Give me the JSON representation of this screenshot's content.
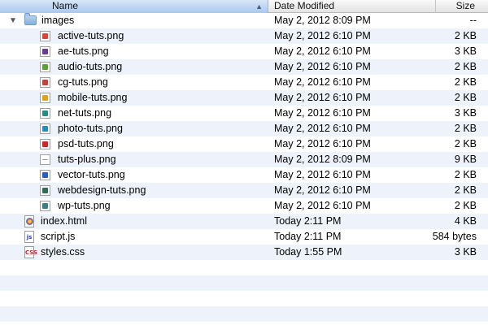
{
  "header": {
    "name": "Name",
    "date_modified": "Date Modified",
    "size": "Size"
  },
  "folder": {
    "name": "images",
    "date": "May 2, 2012 8:09 PM",
    "size": "--",
    "files": [
      {
        "name": "active-tuts.png",
        "date": "May 2, 2012 6:10 PM",
        "size": "2 KB",
        "color": "#d8453a"
      },
      {
        "name": "ae-tuts.png",
        "date": "May 2, 2012 6:10 PM",
        "size": "3 KB",
        "color": "#6a3d8f"
      },
      {
        "name": "audio-tuts.png",
        "date": "May 2, 2012 6:10 PM",
        "size": "2 KB",
        "color": "#5aa032"
      },
      {
        "name": "cg-tuts.png",
        "date": "May 2, 2012 6:10 PM",
        "size": "2 KB",
        "color": "#c2453c"
      },
      {
        "name": "mobile-tuts.png",
        "date": "May 2, 2012 6:10 PM",
        "size": "2 KB",
        "color": "#e0a020"
      },
      {
        "name": "net-tuts.png",
        "date": "May 2, 2012 6:10 PM",
        "size": "3 KB",
        "color": "#2a8a84"
      },
      {
        "name": "photo-tuts.png",
        "date": "May 2, 2012 6:10 PM",
        "size": "2 KB",
        "color": "#2a8bc0"
      },
      {
        "name": "psd-tuts.png",
        "date": "May 2, 2012 6:10 PM",
        "size": "2 KB",
        "color": "#c82a2a"
      },
      {
        "name": "tuts-plus.png",
        "date": "May 2, 2012 8:09 PM",
        "size": "9 KB",
        "color": "#999999"
      },
      {
        "name": "vector-tuts.png",
        "date": "May 2, 2012 6:10 PM",
        "size": "2 KB",
        "color": "#2a5fb8"
      },
      {
        "name": "webdesign-tuts.png",
        "date": "May 2, 2012 6:10 PM",
        "size": "2 KB",
        "color": "#2f6e5a"
      },
      {
        "name": "wp-tuts.png",
        "date": "May 2, 2012 6:10 PM",
        "size": "2 KB",
        "color": "#3a7f86"
      }
    ]
  },
  "root_files": [
    {
      "name": "index.html",
      "date": "Today 2:11 PM",
      "size": "4 KB",
      "icon": "html-file-icon"
    },
    {
      "name": "script.js",
      "date": "Today 2:11 PM",
      "size": "584 bytes",
      "icon": "js-file-icon",
      "badge": "js"
    },
    {
      "name": "styles.css",
      "date": "Today 1:55 PM",
      "size": "3 KB",
      "icon": "css-file-icon",
      "badge": "CSS"
    }
  ],
  "empty_rows": 4,
  "colors": {
    "header_selected": "#a9c7ee",
    "stripe": "#eef3fb"
  }
}
